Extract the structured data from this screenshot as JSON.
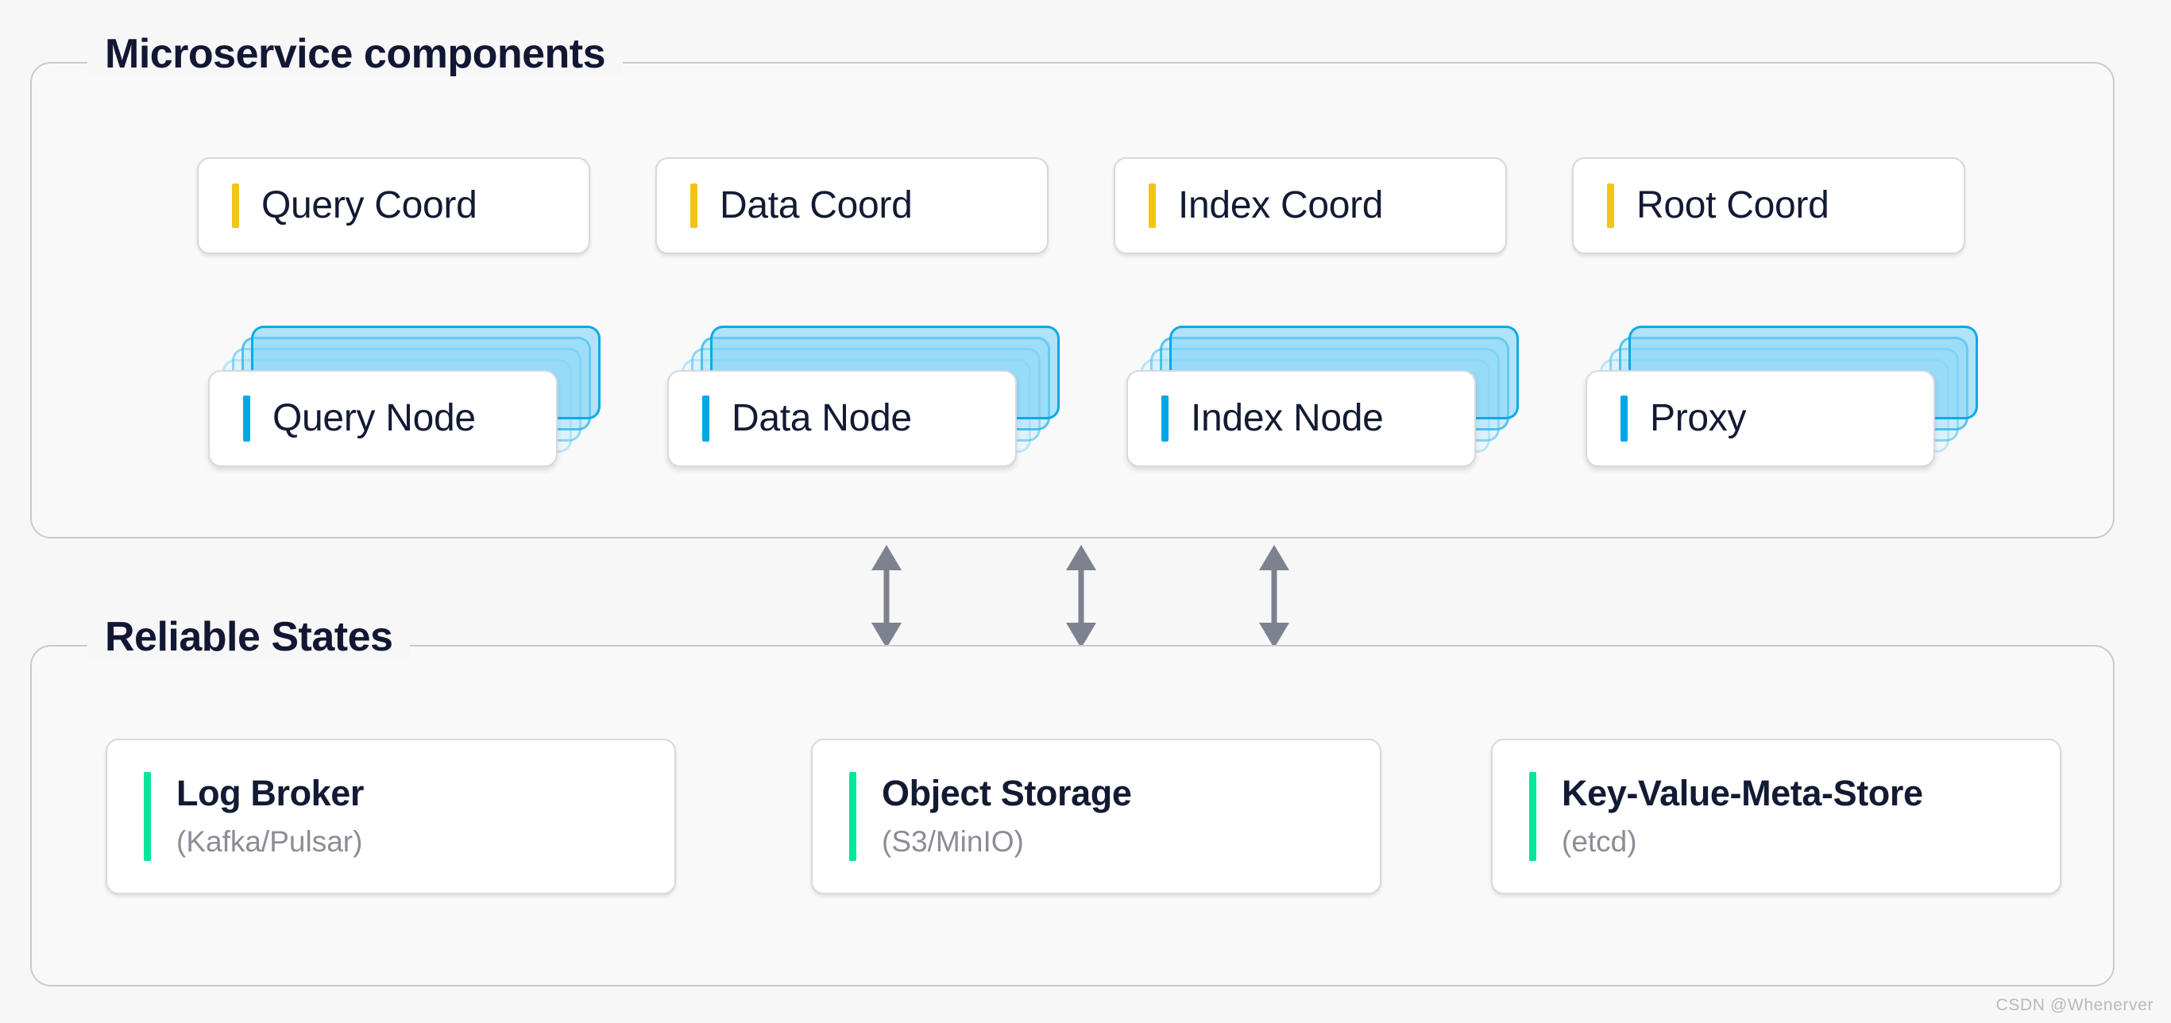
{
  "colors": {
    "background": "#f7f7f8",
    "section_border": "#c9c9d1",
    "card_border": "#d8d8de",
    "text_dark": "#131a33",
    "text_muted": "#8c8c96",
    "accent_coord_yellow": "#f2c511",
    "accent_node_cyan": "#00a7e6",
    "accent_state_green": "#00e599",
    "arrow_gray": "#7d8190"
  },
  "sections": {
    "microservice": {
      "legend": "Microservice components",
      "coordinators": [
        {
          "label": "Query Coord",
          "accent": "yellow"
        },
        {
          "label": "Data Coord",
          "accent": "yellow"
        },
        {
          "label": "Index Coord",
          "accent": "yellow"
        },
        {
          "label": "Root Coord",
          "accent": "yellow"
        }
      ],
      "nodes": [
        {
          "label": "Query Node",
          "accent": "cyan",
          "stacked": true,
          "stack_layers": 4
        },
        {
          "label": "Data Node",
          "accent": "cyan",
          "stacked": true,
          "stack_layers": 4
        },
        {
          "label": "Index Node",
          "accent": "cyan",
          "stacked": true,
          "stack_layers": 4
        },
        {
          "label": "Proxy",
          "accent": "cyan",
          "stacked": true,
          "stack_layers": 4
        }
      ]
    },
    "reliable": {
      "legend": "Reliable States",
      "stores": [
        {
          "title": "Log Broker",
          "subtitle": "(Kafka/Pulsar)",
          "accent": "green"
        },
        {
          "title": "Object Storage",
          "subtitle": "(S3/MinIO)",
          "accent": "green"
        },
        {
          "title": "Key-Value-Meta-Store",
          "subtitle": "(etcd)",
          "accent": "green"
        }
      ]
    }
  },
  "connectors": {
    "icon": "double-headed-vertical-arrow",
    "count": 3,
    "direction": "bidirectional"
  },
  "watermark": "CSDN @Whenerver"
}
